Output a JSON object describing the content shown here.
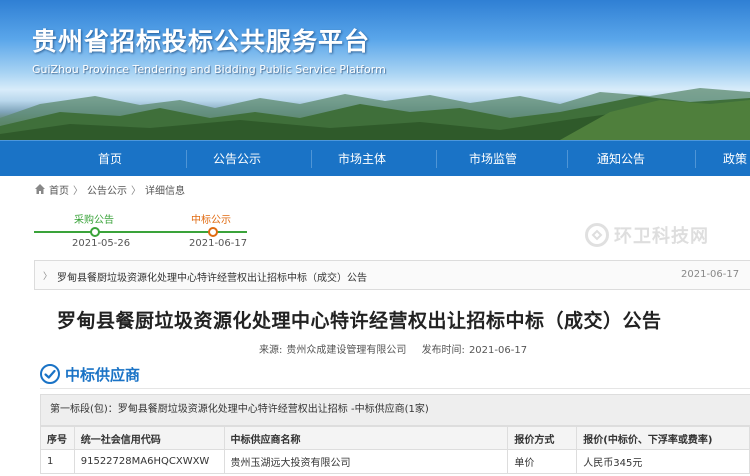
{
  "site": {
    "title": "贵州省招标投标公共服务平台",
    "subtitle": "GuiZhou Province Tendering and Bidding Public Service Platform"
  },
  "nav": [
    {
      "label": "首页"
    },
    {
      "label": "公告公示"
    },
    {
      "label": "市场主体"
    },
    {
      "label": "市场监管"
    },
    {
      "label": "通知公告"
    },
    {
      "label": "政策"
    }
  ],
  "breadcrumb": {
    "home": "首页",
    "section": "公告公示",
    "current": "详细信息",
    "separator": "〉"
  },
  "timeline": {
    "steps": [
      {
        "label": "采购公告",
        "date": "2021-05-26",
        "color": "#3aa33a"
      },
      {
        "label": "中标公示",
        "date": "2021-06-17",
        "color": "#e06a10"
      }
    ]
  },
  "watermark": {
    "text": "环卫科技网"
  },
  "notice": {
    "arrow": "〉",
    "title": "罗甸县餐厨垃圾资源化处理中心特许经营权出让招标中标（成交）公告",
    "date": "2021-06-17"
  },
  "article": {
    "title": "罗甸县餐厨垃圾资源化处理中心特许经营权出让招标中标（成交）公告",
    "source_label": "来源:",
    "source": "贵州众成建设管理有限公司",
    "publish_label": "发布时间:",
    "publish_time": "2021-06-17"
  },
  "section": {
    "title": "中标供应商"
  },
  "package": {
    "text": "第一标段(包)：罗甸县餐厨垃圾资源化处理中心特许经营权出让招标 -中标供应商(1家)"
  },
  "table": {
    "headers": [
      "序号",
      "统一社会信用代码",
      "中标供应商名称",
      "报价方式",
      "报价(中标价、下浮率或费率)"
    ],
    "rows": [
      [
        "1",
        "91522728MA6HQCXWXW",
        "贵州玉湖远大投资有限公司",
        "单价",
        "人民币345元"
      ]
    ]
  },
  "colors": {
    "nav_bg": "#1a73c6",
    "accent": "#1a73c6",
    "timeline_green": "#3aa33a",
    "timeline_orange": "#e06a10"
  }
}
